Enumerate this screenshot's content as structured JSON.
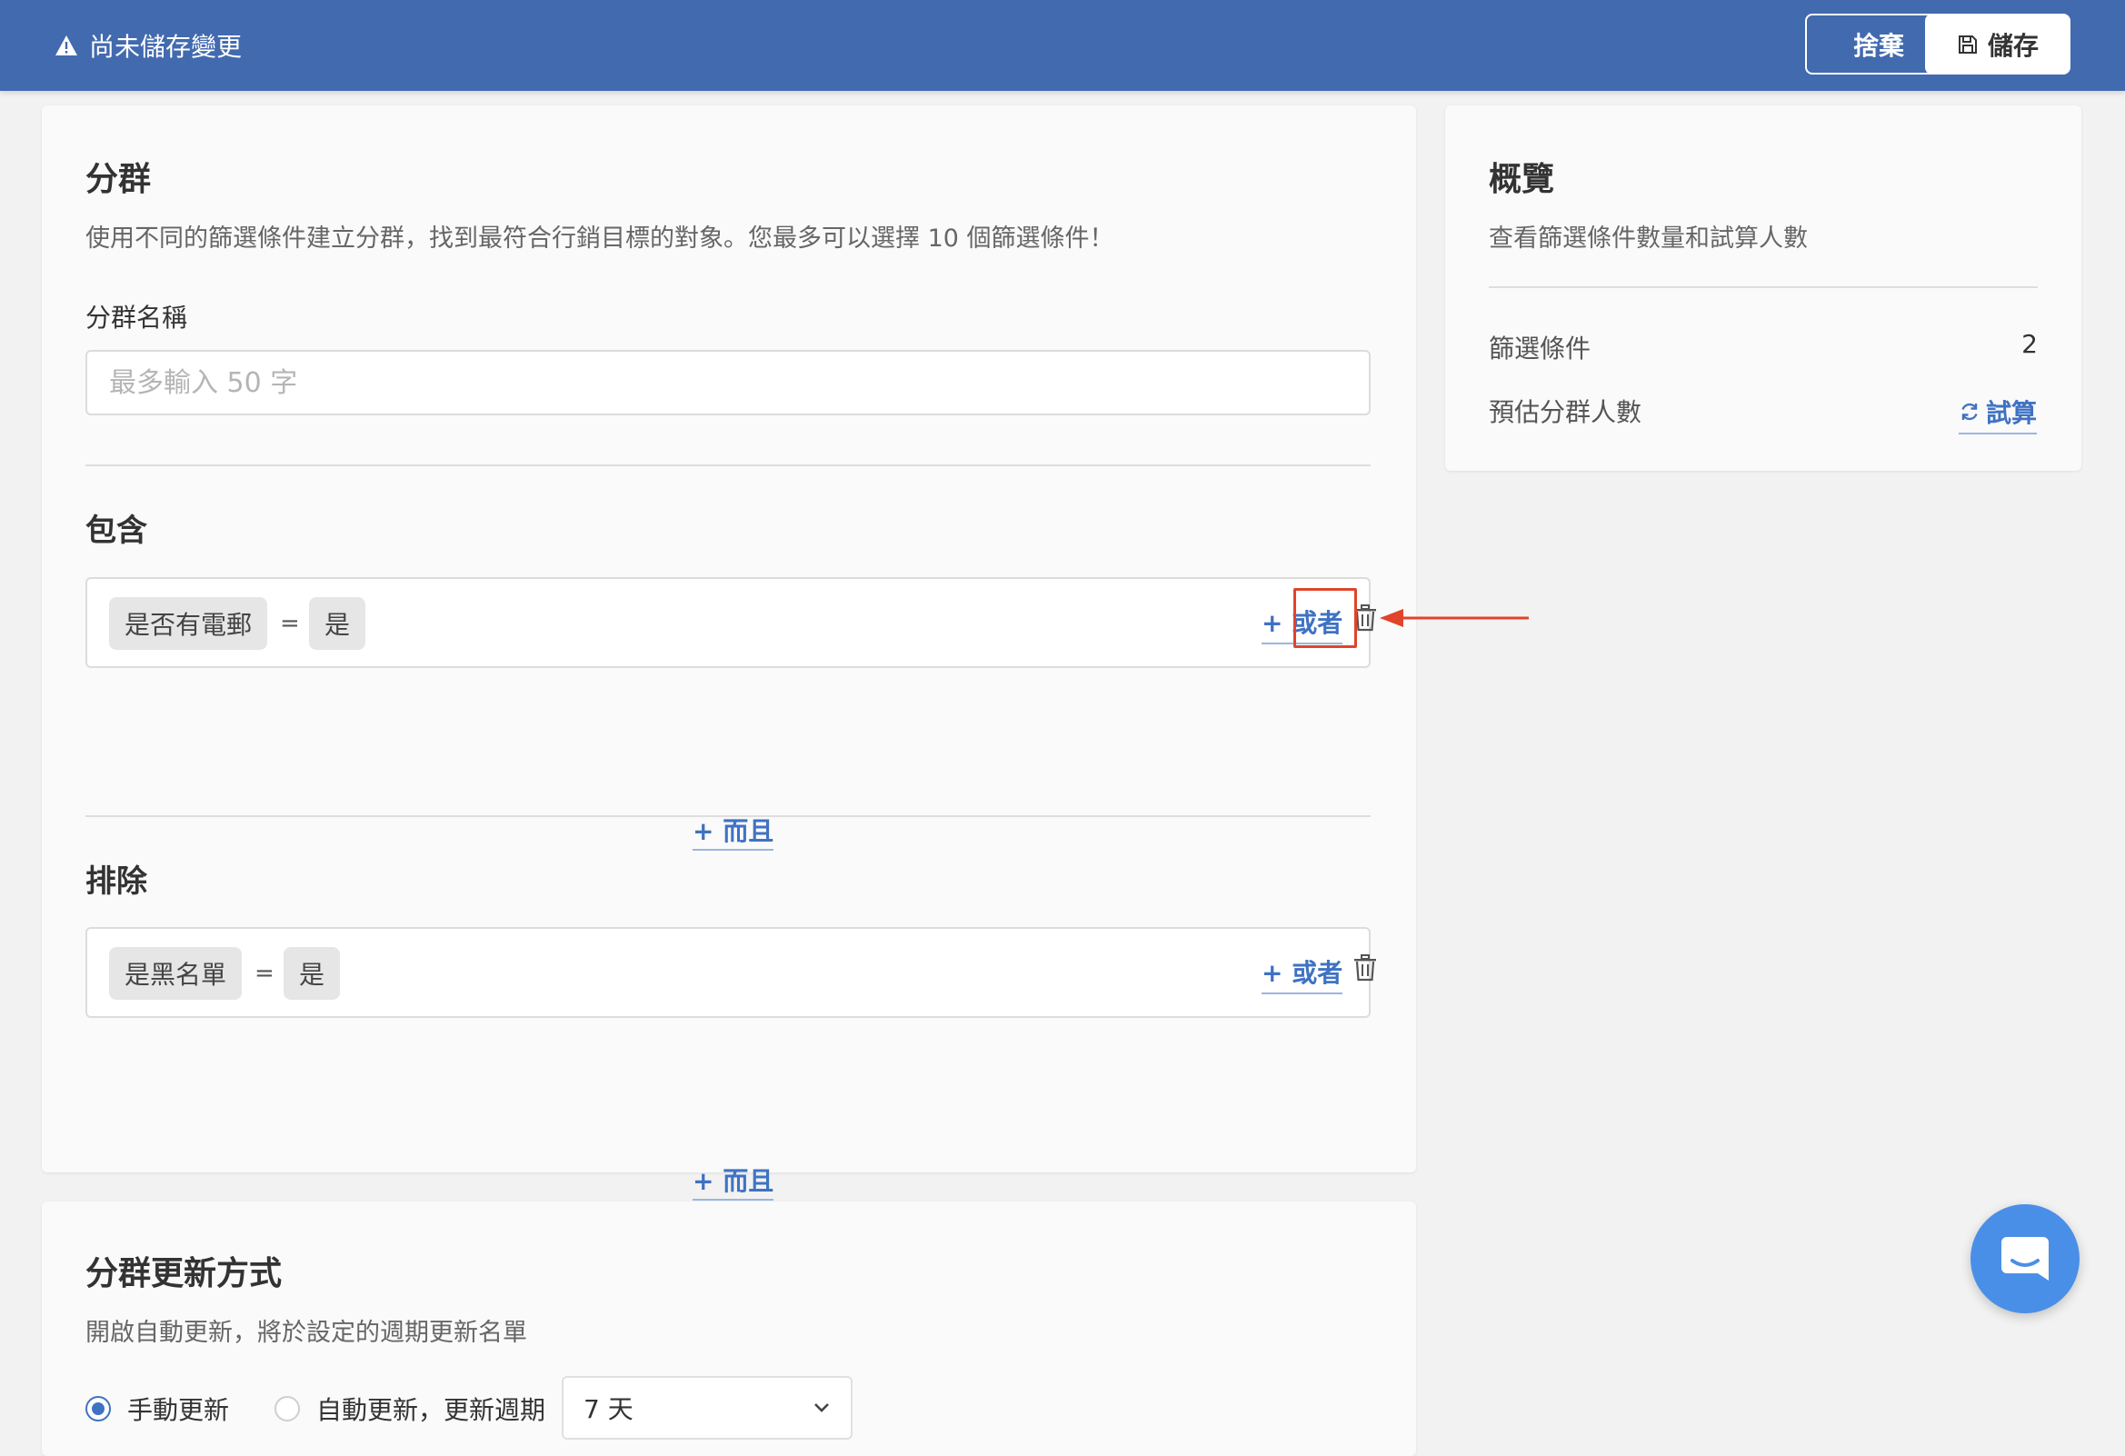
{
  "topbar": {
    "warning_text": "尚未儲存變更",
    "discard_label": "捨棄",
    "save_label": "儲存"
  },
  "segment": {
    "title": "分群",
    "description": "使用不同的篩選條件建立分群，找到最符合行銷目標的對象。您最多可以選擇 10 個篩選條件！",
    "name_label": "分群名稱",
    "name_placeholder": "最多輸入 50 字",
    "name_value": ""
  },
  "include": {
    "title": "包含",
    "condition": {
      "field": "是否有電郵",
      "operator": "=",
      "value": "是"
    },
    "or_label": "+ 或者",
    "and_label": "+ 而且"
  },
  "exclude": {
    "title": "排除",
    "condition": {
      "field": "是黑名單",
      "operator": "=",
      "value": "是"
    },
    "or_label": "+ 或者",
    "and_label": "+ 而且"
  },
  "overview": {
    "title": "概覽",
    "description": "查看篩選條件數量和試算人數",
    "filters_label": "篩選條件",
    "filters_count": "2",
    "estimate_label": "預估分群人數",
    "calc_label": "試算"
  },
  "update": {
    "title": "分群更新方式",
    "description": "開啟自動更新，將於設定的週期更新名單",
    "manual_label": "手動更新",
    "auto_label": "自動更新，更新週期",
    "selected_mode": "manual",
    "period_value": "7 天"
  },
  "icons": {
    "warning": "warning-triangle-icon",
    "save": "floppy-disk-icon",
    "trash": "trash-icon",
    "refresh": "refresh-icon",
    "chevron": "chevron-down-icon",
    "chat": "chat-bubble-icon",
    "annotation_arrow": "arrow-left-icon"
  },
  "colors": {
    "topbar": "#426aaf",
    "link": "#3f72c3",
    "highlight": "#e0442b",
    "chat": "#4a8fe7"
  }
}
